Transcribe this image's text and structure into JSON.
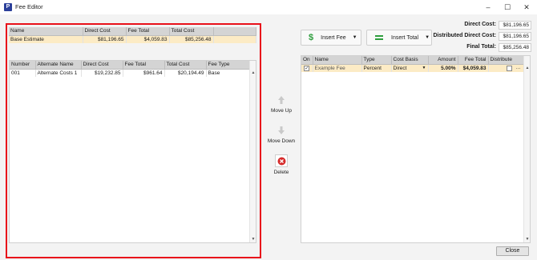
{
  "window": {
    "title": "Fee Editor",
    "minimize": "–",
    "maximize": "☐",
    "close": "✕"
  },
  "summary_table": {
    "headers": [
      "Name",
      "Direct Cost",
      "Fee Total",
      "Total Cost"
    ],
    "rows": [
      {
        "name": "Base Estimate",
        "direct_cost": "$81,196.65",
        "fee_total": "$4,059.83",
        "total_cost": "$85,256.48"
      }
    ]
  },
  "alternates_table": {
    "headers": [
      "Number",
      "Alternate Name",
      "Direct Cost",
      "Fee Total",
      "Total Cost",
      "Fee Type"
    ],
    "rows": [
      {
        "number": "001",
        "alternate_name": "Alternate Costs 1",
        "direct_cost": "$19,232.85",
        "fee_total": "$961.64",
        "total_cost": "$20,194.49",
        "fee_type": "Base"
      }
    ]
  },
  "side_actions": {
    "move_up": "Move Up",
    "move_down": "Move Down",
    "delete": "Delete"
  },
  "toolbar": {
    "insert_fee": "Insert Fee",
    "insert_total": "Insert Total"
  },
  "summary": {
    "direct_cost_label": "Direct Cost:",
    "direct_cost": "$81,196.65",
    "distributed_label": "Distributed Direct Cost:",
    "distributed": "$81,196.65",
    "final_label": "Final Total:",
    "final": "$85,256.48"
  },
  "fees_table": {
    "headers": [
      "On",
      "Name",
      "Type",
      "Cost Basis",
      "Amount",
      "Fee Total",
      "Distribute"
    ],
    "rows": [
      {
        "on": "✓",
        "name": "Example Fee",
        "type": "Percent",
        "cost_basis": "Direct",
        "amount": "5.00%",
        "fee_total": "$4,059.83",
        "more": "···"
      }
    ]
  },
  "footer": {
    "close": "Close"
  },
  "colors": {
    "highlight": "#e8101a",
    "selected_row": "#fcebc5",
    "dollar_icon": "#2e9e3e",
    "delete_icon": "#d62a2a"
  },
  "icons": [
    "app-icon",
    "dollar-icon",
    "equals-icon",
    "move-up-icon",
    "move-down-icon",
    "delete-icon",
    "dropdown-arrow-icon"
  ]
}
